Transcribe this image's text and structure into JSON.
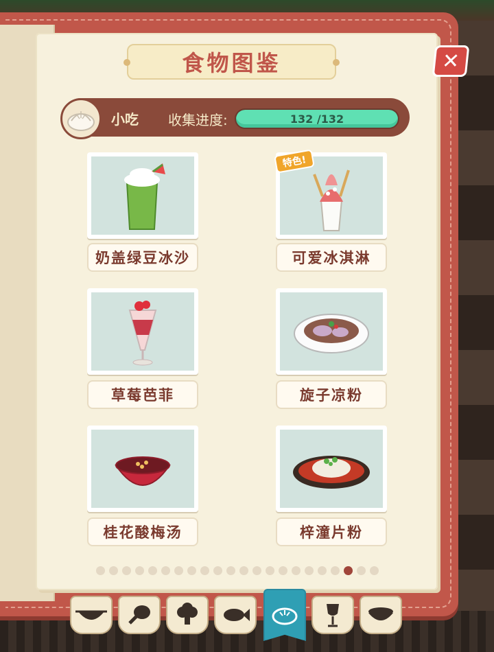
{
  "title": "食物图鉴",
  "close_label": "✕",
  "category": {
    "label": "小吃",
    "icon": "bun-icon",
    "progress_label": "收集进度:",
    "progress_text": "132 /132",
    "collected": 132,
    "total": 132
  },
  "foods": [
    {
      "name": "奶盖绿豆冰沙",
      "icon": "green-smoothie-icon",
      "special": ""
    },
    {
      "name": "可爱冰淇淋",
      "icon": "ice-cream-cup-icon",
      "special": "特色!"
    },
    {
      "name": "草莓芭菲",
      "icon": "strawberry-parfait-icon",
      "special": ""
    },
    {
      "name": "旋子凉粉",
      "icon": "cold-jelly-noodle-icon",
      "special": ""
    },
    {
      "name": "桂花酸梅汤",
      "icon": "plum-soup-bowl-icon",
      "special": ""
    },
    {
      "name": "梓潼片粉",
      "icon": "rice-noodle-plate-icon",
      "special": ""
    }
  ],
  "pager": {
    "count": 22,
    "active_index": 19
  },
  "tabs": [
    {
      "icon": "wok-icon",
      "active": false
    },
    {
      "icon": "drumstick-icon",
      "active": false
    },
    {
      "icon": "broccoli-icon",
      "active": false
    },
    {
      "icon": "fish-icon",
      "active": false
    },
    {
      "icon": "bun-icon",
      "active": true
    },
    {
      "icon": "wine-glass-icon",
      "active": false
    },
    {
      "icon": "soup-pot-icon",
      "active": false
    }
  ],
  "colors": {
    "book_cover": "#c1574a",
    "page": "#f7f1dd",
    "title": "#c0564a",
    "category_bar": "#8a4a3a",
    "progress_fill": "#5fe0b3",
    "active_tab": "#2f9fb4",
    "active_dot": "#a0453a"
  }
}
